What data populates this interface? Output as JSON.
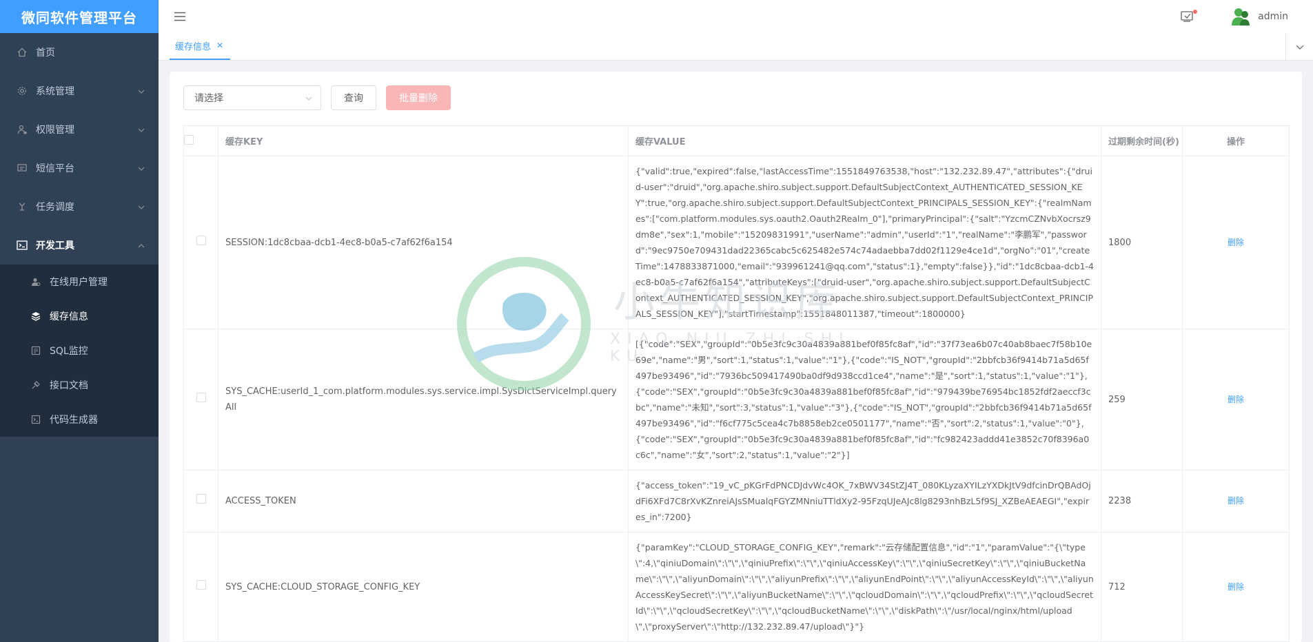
{
  "app": {
    "logo_title": "微同软件管理平台"
  },
  "sidebar": {
    "items": [
      {
        "label": "首页",
        "icon": "home-icon"
      },
      {
        "label": "系统管理",
        "icon": "gear-icon"
      },
      {
        "label": "权限管理",
        "icon": "user-lock-icon"
      },
      {
        "label": "短信平台",
        "icon": "message-icon"
      },
      {
        "label": "任务调度",
        "icon": "schedule-icon"
      },
      {
        "label": "开发工具",
        "icon": "tools-icon"
      }
    ],
    "dev_tools_sub": [
      {
        "label": "在线用户管理",
        "icon": "users-icon"
      },
      {
        "label": "缓存信息",
        "icon": "layers-icon"
      },
      {
        "label": "SQL监控",
        "icon": "monitor-icon"
      },
      {
        "label": "接口文档",
        "icon": "api-doc-icon"
      },
      {
        "label": "代码生成器",
        "icon": "code-icon"
      }
    ]
  },
  "header": {
    "username": "admin"
  },
  "tabs": [
    {
      "label": "缓存信息"
    }
  ],
  "toolbar": {
    "select_placeholder": "请选择",
    "query_label": "查询",
    "batch_delete_label": "批量删除"
  },
  "table": {
    "headers": [
      "缓存KEY",
      "缓存VALUE",
      "过期剩余时间(秒)",
      "操作"
    ],
    "rows": [
      {
        "key": "SESSION:1dc8cbaa-dcb1-4ec8-b0a5-c7af62f6a154",
        "value": "{\"valid\":true,\"expired\":false,\"lastAccessTime\":1551849763538,\"host\":\"132.232.89.47\",\"attributes\":{\"druid-user\":\"druid\",\"org.apache.shiro.subject.support.DefaultSubjectContext_AUTHENTICATED_SESSION_KEY\":true,\"org.apache.shiro.subject.support.DefaultSubjectContext_PRINCIPALS_SESSION_KEY\":{\"realmNames\":[\"com.platform.modules.sys.oauth2.Oauth2Realm_0\"],\"primaryPrincipal\":{\"salt\":\"YzcmCZNvbXocrsz9dm8e\",\"sex\":1,\"mobile\":\"15209831991\",\"userName\":\"admin\",\"userId\":\"1\",\"realName\":\"李鹏军\",\"password\":\"9ec9750e709431dad22365cabc5c625482e574c74adaebba7dd02f1129e4ce1d\",\"orgNo\":\"01\",\"createTime\":1478833871000,\"email\":\"939961241@qq.com\",\"status\":1},\"empty\":false}},\"id\":\"1dc8cbaa-dcb1-4ec8-b0a5-c7af62f6a154\",\"attributeKeys\":[\"druid-user\",\"org.apache.shiro.subject.support.DefaultSubjectContext_AUTHENTICATED_SESSION_KEY\",\"org.apache.shiro.subject.support.DefaultSubjectContext_PRINCIPALS_SESSION_KEY\"],\"startTimestamp\":1551848011387,\"timeout\":1800000}",
        "ttl": "1800",
        "action": "删除"
      },
      {
        "key": "SYS_CACHE:userId_1_com.platform.modules.sys.service.impl.SysDictServiceImpl.queryAll",
        "value": "[{\"code\":\"SEX\",\"groupId\":\"0b5e3fc9c30a4839a881bef0f85fc8af\",\"id\":\"37f73ea6b07c40ab8baec7f58b10e69e\",\"name\":\"男\",\"sort\":1,\"status\":1,\"value\":\"1\"},{\"code\":\"IS_NOT\",\"groupId\":\"2bbfcb36f9414b71a5d65f497be93496\",\"id\":\"7936bc509417490ba0df9d938ccd1ce4\",\"name\":\"是\",\"sort\":1,\"status\":1,\"value\":\"1\"},{\"code\":\"SEX\",\"groupId\":\"0b5e3fc9c30a4839a881bef0f85fc8af\",\"id\":\"979439be76954bc1852fdf2aeccf3cbc\",\"name\":\"未知\",\"sort\":3,\"status\":1,\"value\":\"3\"},{\"code\":\"IS_NOT\",\"groupId\":\"2bbfcb36f9414b71a5d65f497be93496\",\"id\":\"f6cf775c5cea4c7b8858eb2ce0501177\",\"name\":\"否\",\"sort\":2,\"status\":1,\"value\":\"0\"},{\"code\":\"SEX\",\"groupId\":\"0b5e3fc9c30a4839a881bef0f85fc8af\",\"id\":\"fc982423addd41e3852c70f8396a0c6c\",\"name\":\"女\",\"sort\":2,\"status\":1,\"value\":\"2\"}]",
        "ttl": "259",
        "action": "删除"
      },
      {
        "key": "ACCESS_TOKEN",
        "value": "{\"access_token\":\"19_vC_pKGrFdPNCDJdvWc4OK_7xBWV34StZJ4T_080KLyzaXYILzYXDkJtV9dfcinDrQBAdOjdFi6XFd7C8rXvKZnreiAJsSMualqFGYZMNniuTTldXy2-95FzqUJeAJc8lg8293nhBzL5f9SJ_XZBeAEAEGI\",\"expires_in\":7200}",
        "ttl": "2238",
        "action": "删除"
      },
      {
        "key": "SYS_CACHE:CLOUD_STORAGE_CONFIG_KEY",
        "value": "{\"paramKey\":\"CLOUD_STORAGE_CONFIG_KEY\",\"remark\":\"云存储配置信息\",\"id\":\"1\",\"paramValue\":\"{\\\"type\\\":4,\\\"qiniuDomain\\\":\\\"\\\",\\\"qiniuPrefix\\\":\\\"\\\",\\\"qiniuAccessKey\\\":\\\"\\\",\\\"qiniuSecretKey\\\":\\\"\\\",\\\"qiniuBucketName\\\":\\\"\\\",\\\"aliyunDomain\\\":\\\"\\\",\\\"aliyunPrefix\\\":\\\"\\\",\\\"aliyunEndPoint\\\":\\\"\\\",\\\"aliyunAccessKeyId\\\":\\\"\\\",\\\"aliyunAccessKeySecret\\\":\\\"\\\",\\\"aliyunBucketName\\\":\\\"\\\",\\\"qcloudDomain\\\":\\\"\\\",\\\"qcloudPrefix\\\":\\\"\\\",\\\"qcloudSecretId\\\":\\\"\\\",\\\"qcloudSecretKey\\\":\\\"\\\",\\\"qcloudBucketName\\\":\\\"\\\",\\\"diskPath\\\":\\\"/usr/local/nginx/html/upload\\\",\\\"proxyServer\\\":\\\"http://132.232.89.47/upload\\\"}\"}",
        "ttl": "712",
        "action": "删除"
      }
    ]
  },
  "watermark": {
    "text": "小牛知识库",
    "sub": "XIAO NIU ZHI SHI KU"
  },
  "colors": {
    "sidebar_bg": "#304156",
    "submenu_bg": "#1f2d3d",
    "logo_bg": "#409eff",
    "accent": "#409eff",
    "danger_disabled": "#fab6b6"
  }
}
